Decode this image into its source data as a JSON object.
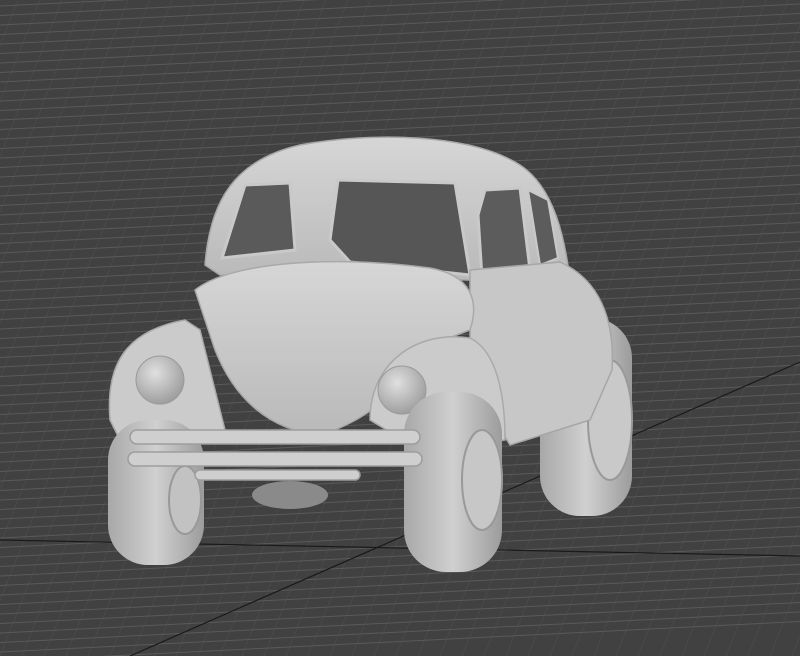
{
  "viewport": {
    "label": "",
    "background_color": "#414141",
    "grid_color": "#5a5a5a",
    "model_color": "#d8d8d8",
    "shading": "smooth-shaded"
  },
  "model": {
    "icon": "car-model-icon"
  }
}
